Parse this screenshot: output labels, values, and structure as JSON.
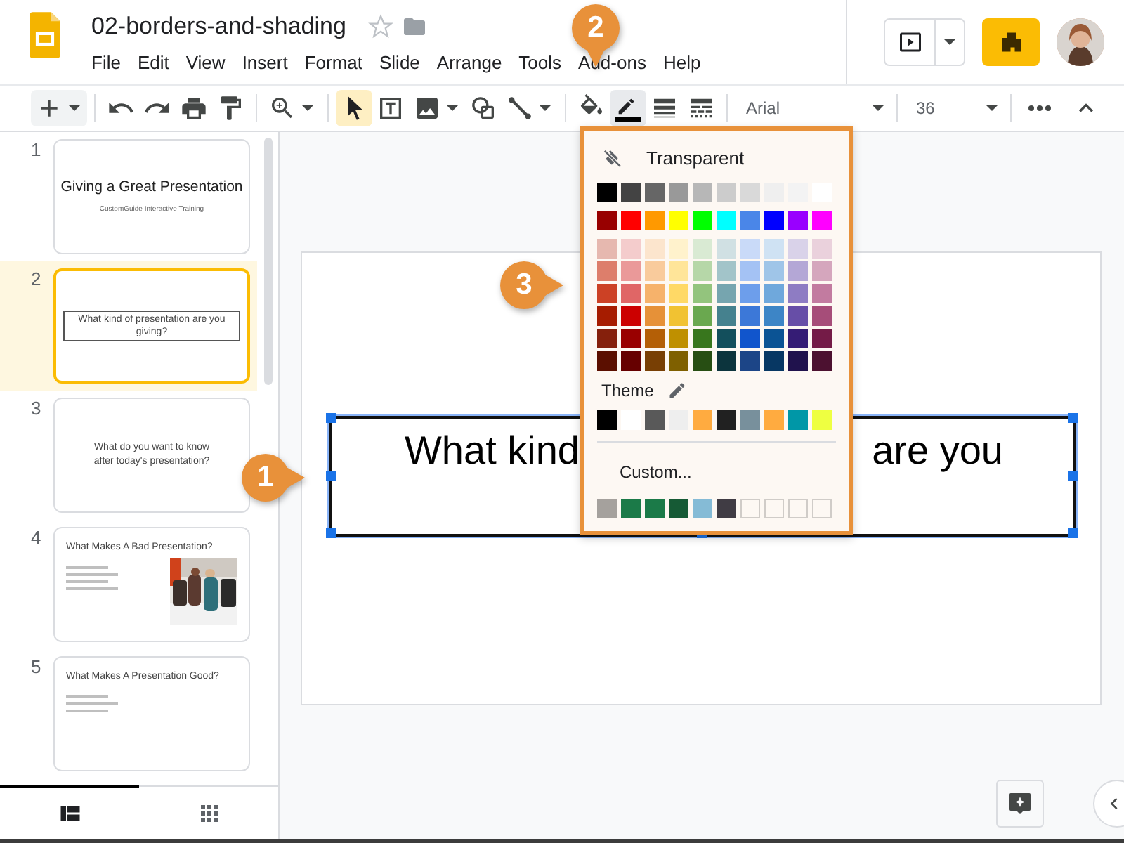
{
  "document": {
    "title": "02-borders-and-shading"
  },
  "menus": [
    {
      "label": "File"
    },
    {
      "label": "Edit"
    },
    {
      "label": "View"
    },
    {
      "label": "Insert"
    },
    {
      "label": "Format"
    },
    {
      "label": "Slide"
    },
    {
      "label": "Arrange"
    },
    {
      "label": "Tools"
    },
    {
      "label": "Add-ons"
    },
    {
      "label": "Help"
    }
  ],
  "toolbar": {
    "groups": [
      [
        {
          "kind": "icon",
          "selected": false
        }
      ],
      [
        {
          "kind": "icon",
          "selected": false
        },
        {
          "kind": "icon",
          "selected": false
        },
        {
          "kind": "icon",
          "selected": false
        },
        {
          "kind": "icon",
          "selected": false
        }
      ],
      [
        {
          "kind": "icon",
          "selected": false
        }
      ],
      [
        {
          "kind": "icon",
          "selected": true
        },
        {
          "kind": "icon",
          "selected": false
        },
        {
          "kind": "icon",
          "selected": false
        },
        {
          "kind": "icon",
          "selected": false
        },
        {
          "kind": "icon",
          "selected": false
        }
      ],
      [
        {
          "kind": "icon",
          "selected": false
        },
        {
          "kind": "icon",
          "selected": false,
          "open": true,
          "color": "#000000"
        },
        {
          "kind": "icon",
          "selected": false
        },
        {
          "kind": "icon",
          "selected": false
        }
      ],
      [
        {
          "kind": "select",
          "value": "Arial"
        }
      ],
      [
        {
          "kind": "select",
          "value": "36"
        }
      ],
      [
        {
          "kind": "icon",
          "selected": false
        }
      ]
    ]
  },
  "slides": [
    {
      "number": "1",
      "selected": false,
      "kind": "title",
      "title": "Giving a Great Presentation",
      "subtitle": "CustomGuide Interactive Training"
    },
    {
      "number": "2",
      "selected": true,
      "kind": "box",
      "text": "What kind of presentation are you giving?"
    },
    {
      "number": "3",
      "selected": false,
      "kind": "text",
      "text": "What do you want to know after today's presentation?"
    },
    {
      "number": "4",
      "selected": false,
      "kind": "bullets_picture",
      "title": "What Makes A Bad Presentation?"
    },
    {
      "number": "5",
      "selected": false,
      "kind": "bullets",
      "title": "What Makes A Presentation Good?"
    }
  ],
  "views": [
    {
      "selected": true
    },
    {
      "selected": false
    }
  ],
  "canvas": {
    "text_left": "What kind",
    "text_right": "are you",
    "selected": true
  },
  "color_menu": {
    "transparent_label": "Transparent",
    "rows": [
      [
        {
          "color": "#000000"
        },
        {
          "color": "#434343"
        },
        {
          "color": "#666666"
        },
        {
          "color": "#999999"
        },
        {
          "color": "#b7b7b7"
        },
        {
          "color": "#cccccc"
        },
        {
          "color": "#d9d9d9"
        },
        {
          "color": "#efefef"
        },
        {
          "color": "#f3f3f3"
        },
        {
          "color": "#ffffff"
        }
      ],
      [
        {
          "color": "#980000"
        },
        {
          "color": "#ff0000"
        },
        {
          "color": "#ff9900"
        },
        {
          "color": "#ffff00"
        },
        {
          "color": "#00ff00"
        },
        {
          "color": "#00ffff"
        },
        {
          "color": "#4a86e8"
        },
        {
          "color": "#0000ff"
        },
        {
          "color": "#9900ff"
        },
        {
          "color": "#ff00ff"
        }
      ],
      [
        {
          "color": "#e6b8af"
        },
        {
          "color": "#f4cccc"
        },
        {
          "color": "#fce5cd"
        },
        {
          "color": "#fff2cc"
        },
        {
          "color": "#d9ead3"
        },
        {
          "color": "#d0e0e3"
        },
        {
          "color": "#c9daf8"
        },
        {
          "color": "#cfe2f3"
        },
        {
          "color": "#d9d2e9"
        },
        {
          "color": "#ead1dc"
        }
      ],
      [
        {
          "color": "#dd7e6b"
        },
        {
          "color": "#ea9999"
        },
        {
          "color": "#f9cb9c"
        },
        {
          "color": "#ffe599"
        },
        {
          "color": "#b6d7a8"
        },
        {
          "color": "#a2c4c9"
        },
        {
          "color": "#a4c2f4"
        },
        {
          "color": "#9fc5e8"
        },
        {
          "color": "#b4a7d6"
        },
        {
          "color": "#d5a6bd"
        }
      ],
      [
        {
          "color": "#cc4125"
        },
        {
          "color": "#e06666"
        },
        {
          "color": "#f6b26b"
        },
        {
          "color": "#ffd966"
        },
        {
          "color": "#93c47d"
        },
        {
          "color": "#76a5af"
        },
        {
          "color": "#6d9eeb"
        },
        {
          "color": "#6fa8dc"
        },
        {
          "color": "#8e7cc3"
        },
        {
          "color": "#c27ba0"
        }
      ],
      [
        {
          "color": "#a61c00"
        },
        {
          "color": "#cc0000"
        },
        {
          "color": "#e69138"
        },
        {
          "color": "#f1c232"
        },
        {
          "color": "#6aa84f"
        },
        {
          "color": "#45818e"
        },
        {
          "color": "#3c78d8"
        },
        {
          "color": "#3d85c6"
        },
        {
          "color": "#674ea7"
        },
        {
          "color": "#a64d79"
        }
      ],
      [
        {
          "color": "#85200c"
        },
        {
          "color": "#990000"
        },
        {
          "color": "#b45f06"
        },
        {
          "color": "#bf9000"
        },
        {
          "color": "#38761d"
        },
        {
          "color": "#134f5c"
        },
        {
          "color": "#1155cc"
        },
        {
          "color": "#0b5394"
        },
        {
          "color": "#351c75"
        },
        {
          "color": "#741b47"
        }
      ],
      [
        {
          "color": "#5b0f00"
        },
        {
          "color": "#660000"
        },
        {
          "color": "#783f04"
        },
        {
          "color": "#7f6000"
        },
        {
          "color": "#274e13"
        },
        {
          "color": "#0c343d"
        },
        {
          "color": "#1c4587"
        },
        {
          "color": "#073763"
        },
        {
          "color": "#20124d"
        },
        {
          "color": "#4c1130"
        }
      ]
    ],
    "theme_label": "Theme",
    "theme": [
      {
        "color": "#000000"
      },
      {
        "color": "#ffffff"
      },
      {
        "color": "#595959"
      },
      {
        "color": "#eeeeee"
      },
      {
        "color": "#ffab40"
      },
      {
        "color": "#212121"
      },
      {
        "color": "#78909c"
      },
      {
        "color": "#ffab40"
      },
      {
        "color": "#0097a7"
      },
      {
        "color": "#eeff41"
      }
    ],
    "custom_label": "Custom...",
    "custom": [
      {
        "kind": "color",
        "color": "#a5a19d"
      },
      {
        "kind": "color",
        "color": "#1b7a48"
      },
      {
        "kind": "color",
        "color": "#1b7a48"
      },
      {
        "kind": "color",
        "color": "#165a35"
      },
      {
        "kind": "color",
        "color": "#85bbd6"
      },
      {
        "kind": "color",
        "color": "#403c44"
      },
      {
        "kind": "empty"
      },
      {
        "kind": "empty"
      },
      {
        "kind": "empty"
      },
      {
        "kind": "empty"
      }
    ]
  },
  "callouts": [
    {
      "number": "1"
    },
    {
      "number": "2"
    },
    {
      "number": "3"
    }
  ]
}
